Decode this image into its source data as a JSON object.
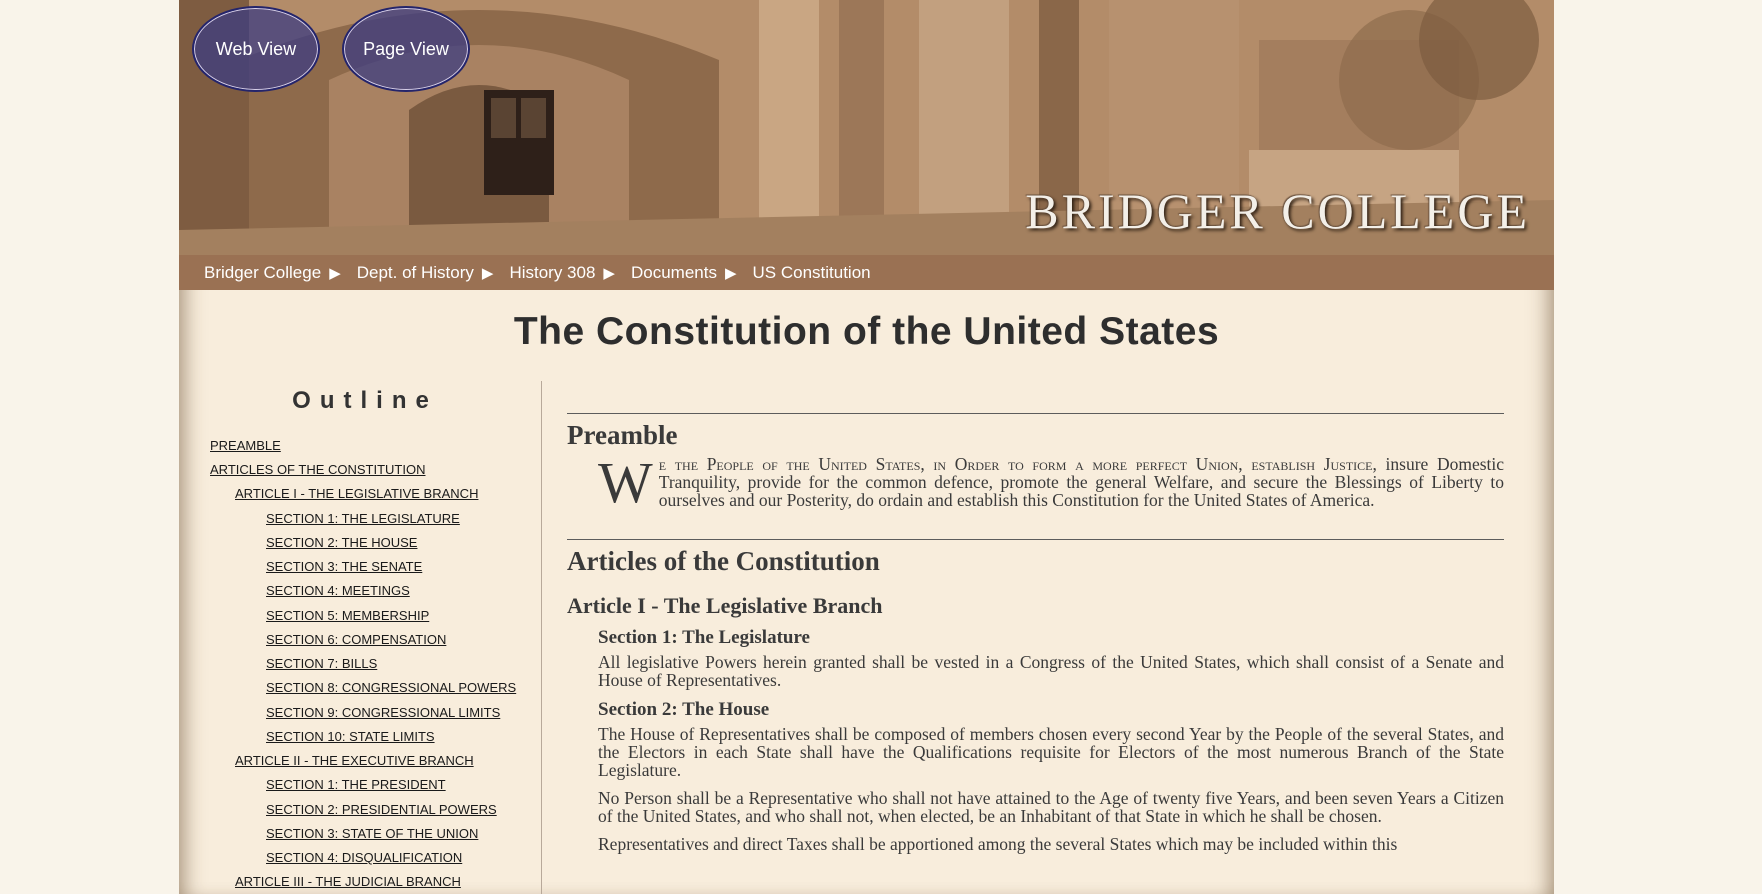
{
  "header": {
    "college_name": "BRIDGER COLLEGE",
    "buttons": {
      "web_view": "Web View",
      "page_view": "Page View"
    }
  },
  "breadcrumb": [
    "Bridger College",
    "Dept. of History",
    "History 308",
    "Documents",
    "US Constitution"
  ],
  "page_title": "The Constitution of the United States",
  "outline": {
    "heading": "Outline",
    "items": [
      {
        "label": "Preamble",
        "level": 0
      },
      {
        "label": "Articles of the Constitution",
        "level": 0
      },
      {
        "label": "Article I - The Legislative Branch",
        "level": 1
      },
      {
        "label": "Section 1: The Legislature",
        "level": 2
      },
      {
        "label": "Section 2: The House",
        "level": 2
      },
      {
        "label": "Section 3: The Senate",
        "level": 2
      },
      {
        "label": "Section 4: Meetings",
        "level": 2
      },
      {
        "label": "Section 5: Membership",
        "level": 2
      },
      {
        "label": "Section 6: Compensation",
        "level": 2
      },
      {
        "label": "Section 7: Bills",
        "level": 2
      },
      {
        "label": "Section 8: Congressional Powers",
        "level": 2
      },
      {
        "label": "Section 9: Congressional Limits",
        "level": 2
      },
      {
        "label": "Section 10: State Limits",
        "level": 2
      },
      {
        "label": "Article II - The Executive Branch",
        "level": 1
      },
      {
        "label": "Section 1: The President",
        "level": 2
      },
      {
        "label": "Section 2: Presidential Powers",
        "level": 2
      },
      {
        "label": "Section 3: State of the Union",
        "level": 2
      },
      {
        "label": "Section 4: Disqualification",
        "level": 2
      },
      {
        "label": "Article III - The Judicial Branch",
        "level": 1
      }
    ]
  },
  "main": {
    "preamble": {
      "heading": "Preamble",
      "dropcap": "W",
      "smallcaps_lead": "e the People of the United States, in Order to form a more perfect Union, establish Justice,",
      "text": "insure Domestic Tranquility, provide for the common defence, promote the general Welfare, and secure the Blessings of Liberty to ourselves and our Posterity, do ordain and establish this Constitution for the United States of America."
    },
    "articles_heading": "Articles of the Constitution",
    "article1": {
      "heading": "Article I - The Legislative Branch",
      "section1": {
        "heading": "Section 1: The Legislature",
        "text": "All legislative Powers herein granted shall be vested in a Congress of the United States, which shall consist of a Senate and House of Representatives."
      },
      "section2": {
        "heading": "Section 2: The House",
        "p1": "The House of Representatives shall be composed of members chosen every second Year by the People of the several States, and the Electors in each State shall have the Qualifications requisite for Electors of the most numerous Branch of the State Legislature.",
        "p2": "No Person shall be a Representative who shall not have attained to the Age of twenty five Years, and been seven Years a Citizen of the United States, and who shall not, when elected, be an Inhabitant of that State in which he shall be chosen.",
        "p3": "Representatives and direct Taxes shall be apportioned among the several States which may be included within this"
      }
    }
  },
  "colors": {
    "nav_bar": "#9a7153",
    "page_bg": "#f8eddc",
    "view_button": "#3c3c82"
  }
}
